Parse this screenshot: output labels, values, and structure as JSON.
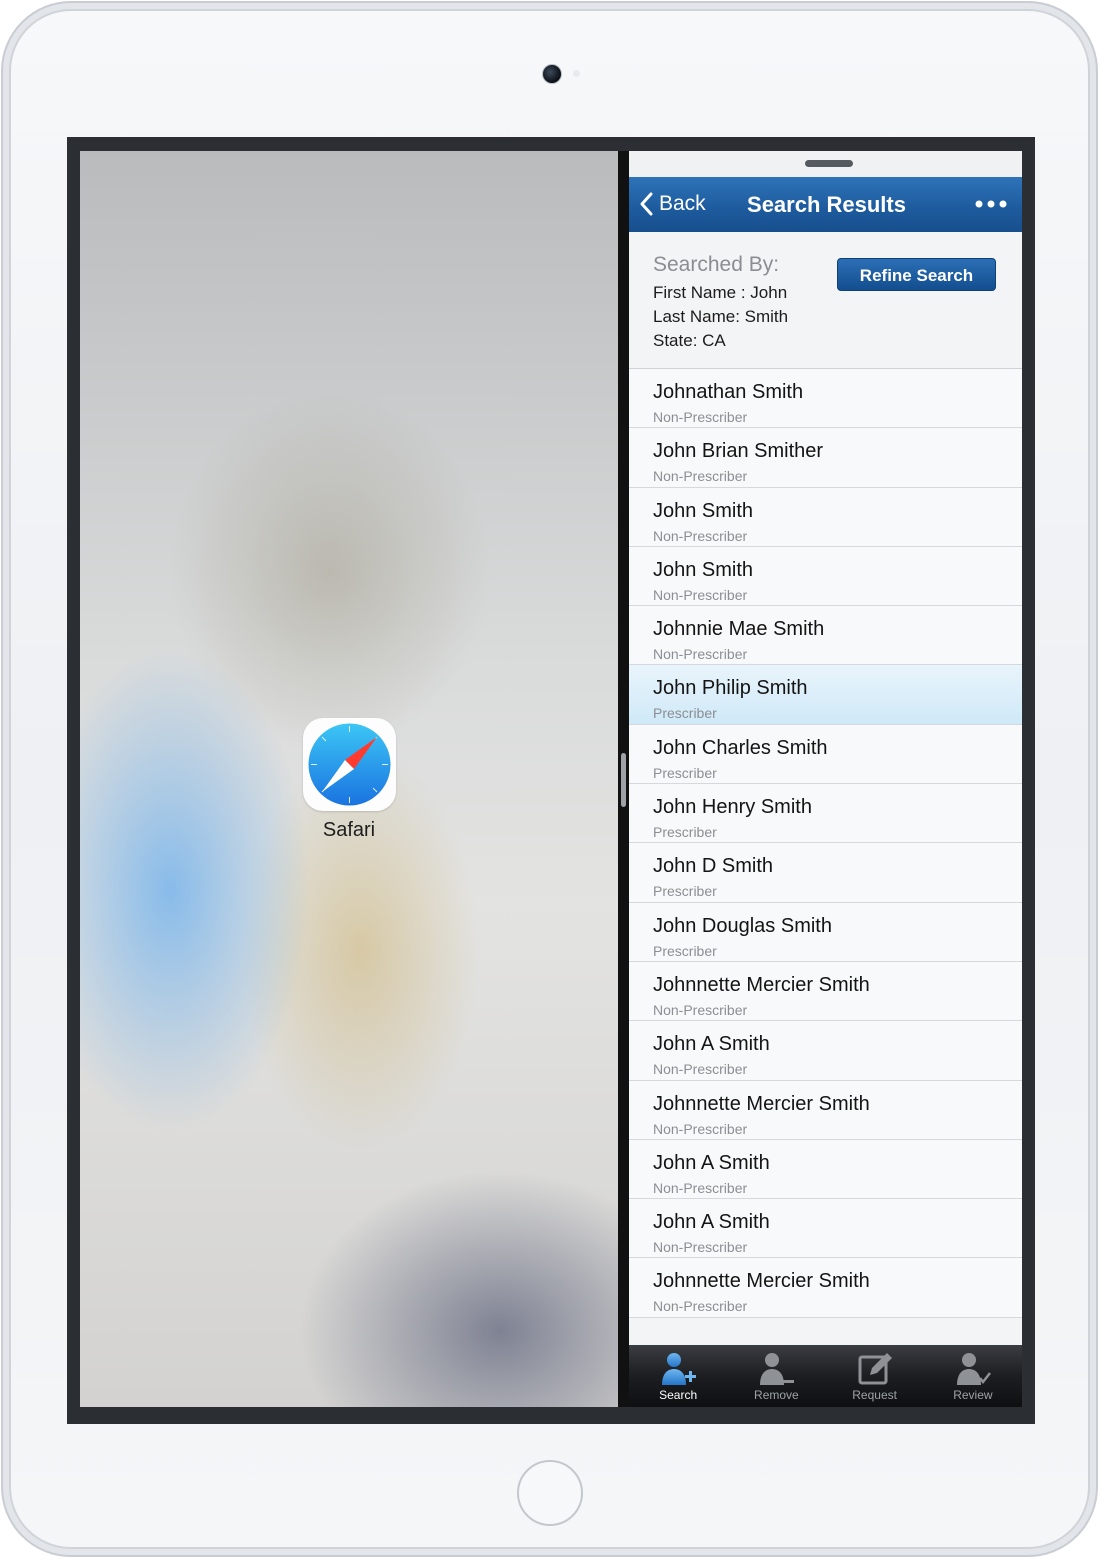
{
  "left_app": {
    "icon_label": "Safari",
    "icon": "safari-compass-icon"
  },
  "navbar": {
    "back_label": "Back",
    "title": "Search Results",
    "accent": "#1e5c9f"
  },
  "search_summary": {
    "heading": "Searched By:",
    "criteria": [
      "First Name : John",
      "Last Name: Smith",
      "State: CA"
    ],
    "refine_label": "Refine Search"
  },
  "results": [
    {
      "name": "Johnathan Smith",
      "type": "Non-Prescriber"
    },
    {
      "name": "John Brian Smither",
      "type": "Non-Prescriber"
    },
    {
      "name": "John Smith",
      "type": "Non-Prescriber"
    },
    {
      "name": "John Smith",
      "type": "Non-Prescriber"
    },
    {
      "name": "Johnnie Mae Smith",
      "type": "Non-Prescriber"
    },
    {
      "name": "John Philip Smith",
      "type": "Prescriber",
      "highlighted": true
    },
    {
      "name": "John Charles Smith",
      "type": "Prescriber"
    },
    {
      "name": "John Henry Smith",
      "type": "Prescriber"
    },
    {
      "name": "John D Smith",
      "type": "Prescriber"
    },
    {
      "name": "John Douglas Smith",
      "type": "Prescriber"
    },
    {
      "name": "Johnnette Mercier Smith",
      "type": "Non-Prescriber"
    },
    {
      "name": "John A Smith",
      "type": "Non-Prescriber"
    },
    {
      "name": "Johnnette Mercier Smith",
      "type": "Non-Prescriber"
    },
    {
      "name": "John A Smith",
      "type": "Non-Prescriber"
    },
    {
      "name": "John A Smith",
      "type": "Non-Prescriber"
    },
    {
      "name": "Johnnette Mercier Smith",
      "type": "Non-Prescriber"
    }
  ],
  "tabbar": {
    "tabs": [
      {
        "label": "Search",
        "icon": "user-add-icon",
        "active": true
      },
      {
        "label": "Remove",
        "icon": "user-remove-icon",
        "active": false
      },
      {
        "label": "Request",
        "icon": "edit-icon",
        "active": false
      },
      {
        "label": "Review",
        "icon": "user-check-icon",
        "active": false
      }
    ]
  }
}
